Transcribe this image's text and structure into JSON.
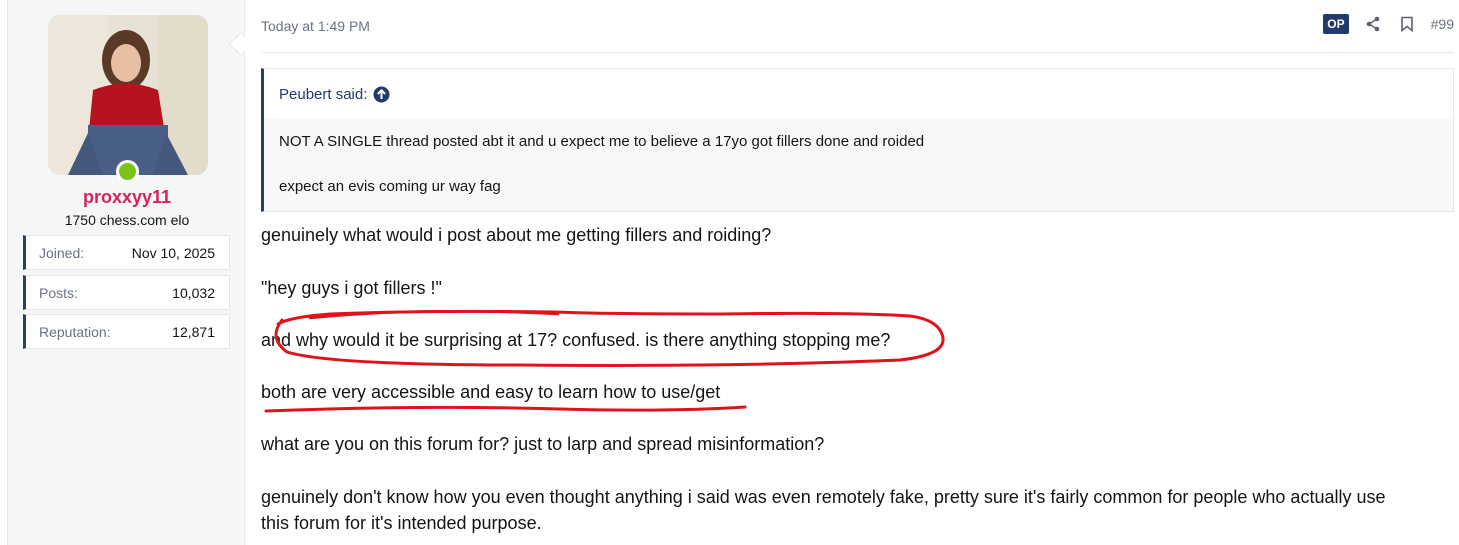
{
  "user": {
    "username": "proxxyy11",
    "title": "1750 chess.com elo",
    "online_color": "#7cc21a",
    "stats": [
      {
        "label": "Joined:",
        "value": "Nov 10, 2025"
      },
      {
        "label": "Posts:",
        "value": "10,032"
      },
      {
        "label": "Reputation:",
        "value": "12,871"
      }
    ]
  },
  "post": {
    "date": "Today at 1:49 PM",
    "op_badge": "OP",
    "number": "#99",
    "quote": {
      "author": "Peubert said:",
      "lines": [
        "NOT A SINGLE thread posted abt it and u expect me to believe a 17yo got fillers done and roided",
        "expect an evis coming ur way fag"
      ]
    },
    "body": [
      "genuinely what would i post about me getting fillers and roiding?",
      "\"hey guys i got fillers !\"",
      "and why would it be surprising at 17? confused. is there anything stopping me?",
      "both are very accessible and easy to learn how to use/get",
      "what are you on this forum for? just to larp and spread misinformation?",
      "genuinely don't know how you even thought anything i said was even remotely fake, pretty sure it's fairly common for people who actually use",
      "this forum for it's intended purpose."
    ]
  },
  "colors": {
    "accent": "#2a3f6e",
    "username": "#d6235f",
    "annotation": "#e0121b"
  }
}
